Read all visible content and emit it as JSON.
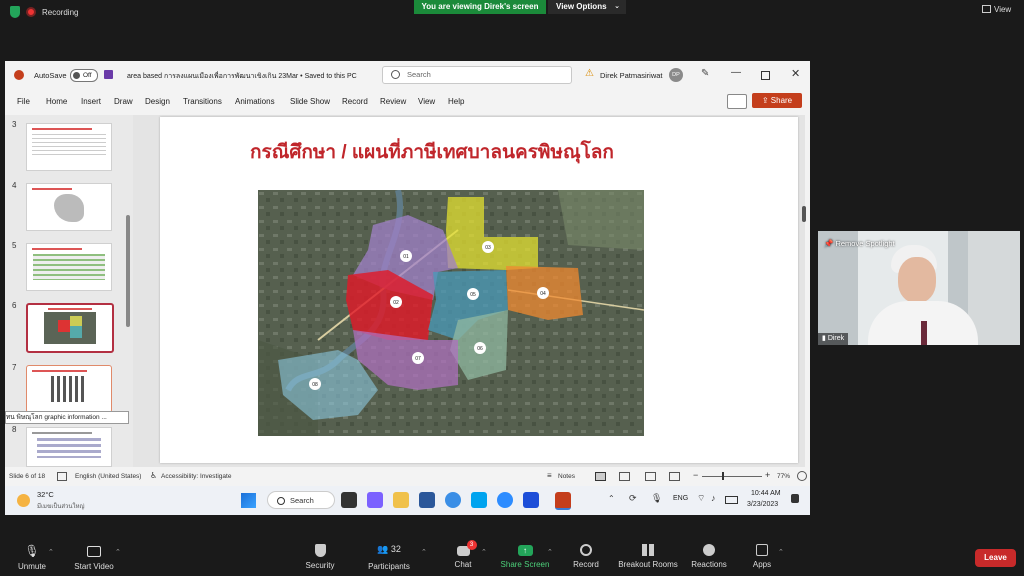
{
  "zoom_top": {
    "recording_label": "Recording",
    "viewing_banner": "You are viewing Direk's screen",
    "view_options": "View Options",
    "view_button": "View"
  },
  "ppt": {
    "autosave_label": "AutoSave",
    "autosave_state": "Off",
    "doc_title": "area based การลงแผนเมืองเพื่อการพัฒนาเขิงเกิน 23Mar • Saved to this PC",
    "search_placeholder": "Search",
    "user_name": "Direk Patmasiriwat",
    "user_initials": "DP",
    "menu": [
      "File",
      "Home",
      "Insert",
      "Draw",
      "Design",
      "Transitions",
      "Animations",
      "Slide Show",
      "Record",
      "Review",
      "View",
      "Help"
    ],
    "share_label": "Share",
    "thumb_numbers": [
      "3",
      "4",
      "5",
      "6",
      "7",
      "8"
    ],
    "tooltip": "ทน พิษณุโลก  graphic information ...",
    "slide_title": "กรณีศึกษา / แผนที่ภาษีเทศบาลนครพิษณุโลก",
    "zones": [
      "01",
      "02",
      "03",
      "04",
      "05",
      "06",
      "07",
      "08"
    ],
    "status": {
      "slide_pos": "Slide 6 of 18",
      "language": "English (United States)",
      "accessibility": "Accessibility: Investigate",
      "notes": "Notes",
      "zoom": "77%"
    }
  },
  "taskbar": {
    "temp": "32°C",
    "weather": "มีเมฆเป็นส่วนใหญ่",
    "search_label": "Search",
    "lang": "ENG",
    "time": "10:44 AM",
    "date": "3/23/2023"
  },
  "video": {
    "spotlight_label": "Remove Spotlight",
    "participant_name": "Direk"
  },
  "zoom_bottom": {
    "unmute": "Unmute",
    "start_video": "Start Video",
    "security": "Security",
    "participants": "Participants",
    "participants_count": "32",
    "chat": "Chat",
    "chat_badge": "3",
    "share_screen": "Share Screen",
    "record": "Record",
    "breakout": "Breakout Rooms",
    "reactions": "Reactions",
    "apps": "Apps",
    "leave": "Leave"
  },
  "colors": {
    "zoom_green": "#1b8a3a",
    "ppt_orange": "#c43e1c",
    "title_red": "#c0262b",
    "leave_red": "#c82a2a"
  }
}
